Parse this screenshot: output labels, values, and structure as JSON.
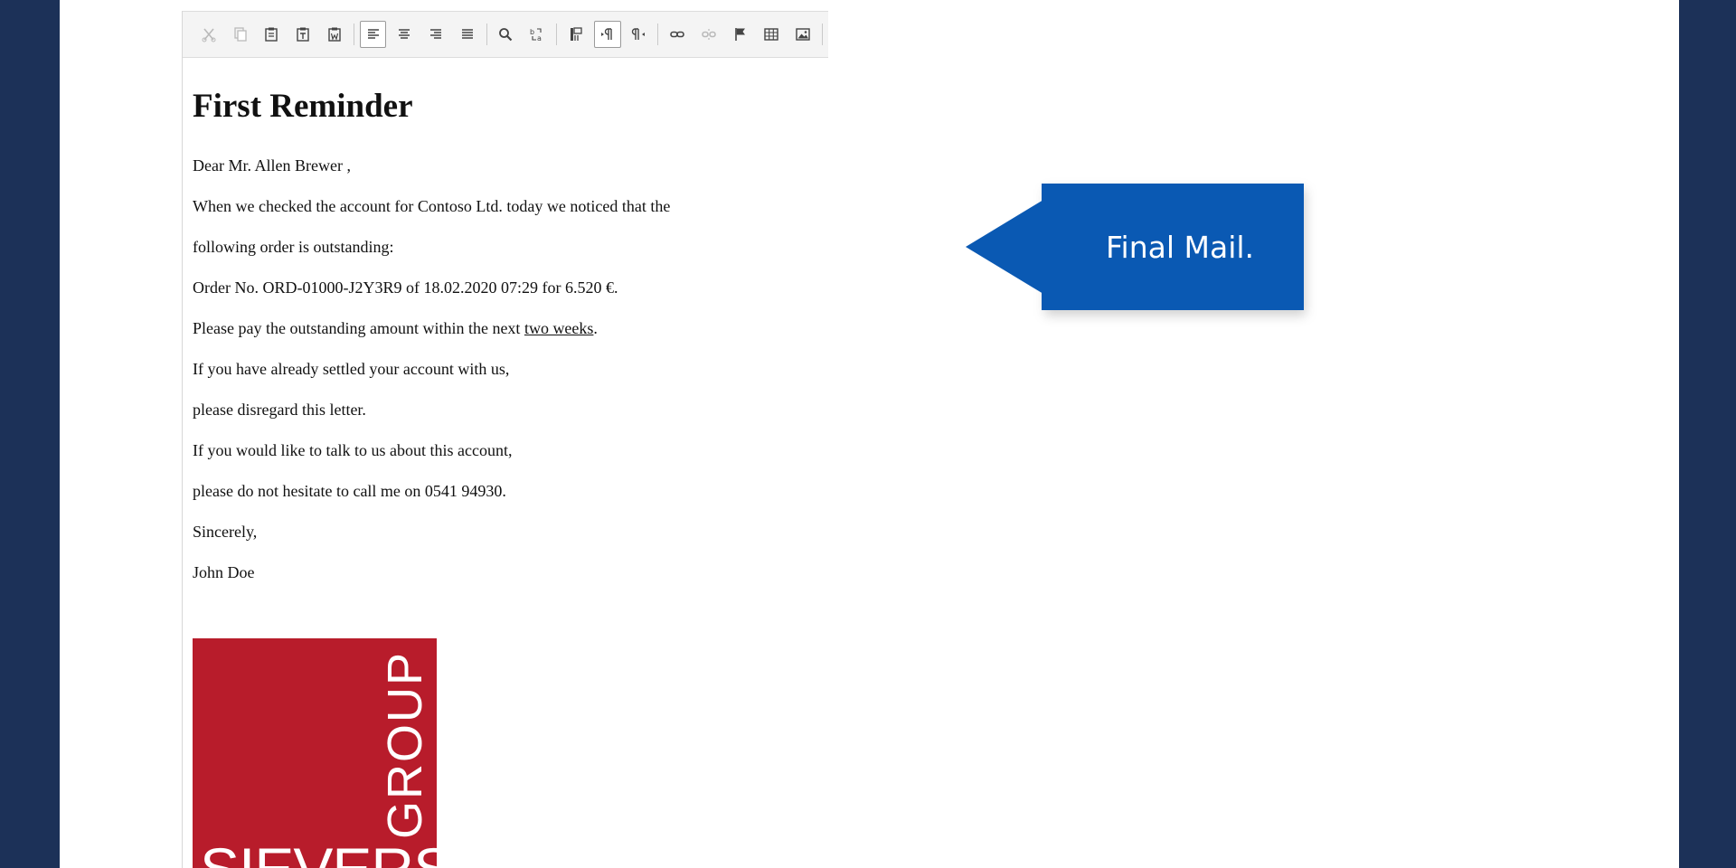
{
  "letter": {
    "title": "First Reminder",
    "greeting": "Dear  Mr. Allen Brewer ,",
    "line1": "When we checked the account for Contoso Ltd. today we noticed that the",
    "line2": "following order is outstanding:",
    "line3": "Order No. ORD-01000-J2Y3R9 of 18.02.2020 07:29 for 6.520 €.",
    "line4_prefix": "Please pay the outstanding amount within the next ",
    "line4_link": "two weeks",
    "line4_suffix": ".",
    "line5": "If you have already settled your account with us,",
    "line6": "please disregard this letter.",
    "line7": "If you would like to talk to us about this account,",
    "line8": "please do not hesitate to call me on 0541 94930.",
    "closing": "Sincerely,",
    "signature": "John Doe"
  },
  "logo": {
    "vertical_text": "GROUP",
    "horizontal_text": "SIEVERS",
    "color": "#b81c2b"
  },
  "callout": {
    "text": "Final Mail.",
    "color": "#0a59b3"
  },
  "toolbar": {
    "buttons": [
      "cut-icon",
      "copy-icon",
      "paste-icon",
      "paste-text-icon",
      "paste-word-icon",
      "align-left-icon",
      "align-center-icon",
      "align-right-icon",
      "justify-icon",
      "find-icon",
      "replace-icon",
      "show-blocks-icon",
      "ltr-icon",
      "rtl-icon",
      "link-icon",
      "unlink-icon",
      "anchor-icon",
      "table-icon",
      "image-icon"
    ],
    "active": [
      "align-left-icon",
      "ltr-icon"
    ]
  },
  "colors": {
    "frame": "#1c3158",
    "background": "#ffffff"
  }
}
